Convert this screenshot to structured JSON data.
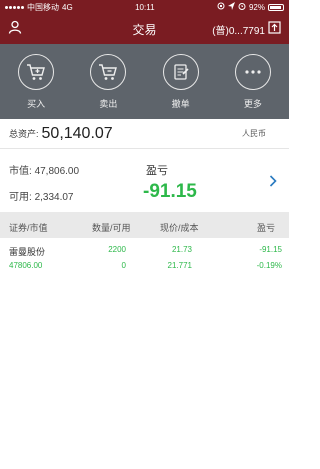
{
  "status_bar": {
    "carrier": "中国移动",
    "network": "4G",
    "time": "10:11",
    "battery": "92%"
  },
  "nav": {
    "title": "交易",
    "account": "(普)0...7791"
  },
  "actions": [
    {
      "label": "买入",
      "icon": "cart-add-icon"
    },
    {
      "label": "卖出",
      "icon": "cart-remove-icon"
    },
    {
      "label": "撤单",
      "icon": "cancel-order-icon"
    },
    {
      "label": "更多",
      "icon": "more-icon"
    }
  ],
  "account": {
    "total_label": "总资产:",
    "total_value": "50,140.07",
    "currency": "人民币",
    "market_value_label": "市值:",
    "market_value": "47,806.00",
    "available_label": "可用:",
    "available": "2,334.07",
    "pl_label": "盈亏",
    "pl_value": "-91.15"
  },
  "table": {
    "headers": [
      "证券/市值",
      "数量/可用",
      "现价/成本",
      "盈亏"
    ],
    "rows": [
      {
        "name": "雷曼股份",
        "quantity": "2200",
        "price": "21.73",
        "pl": "-91.15",
        "market_value": "47806.00",
        "available": "0",
        "cost": "21.771",
        "pl_pct": "-0.19%"
      }
    ]
  },
  "colors": {
    "header_bg": "#7a1c22",
    "action_bg": "#5e646b",
    "gain_green": "#2db84a"
  }
}
